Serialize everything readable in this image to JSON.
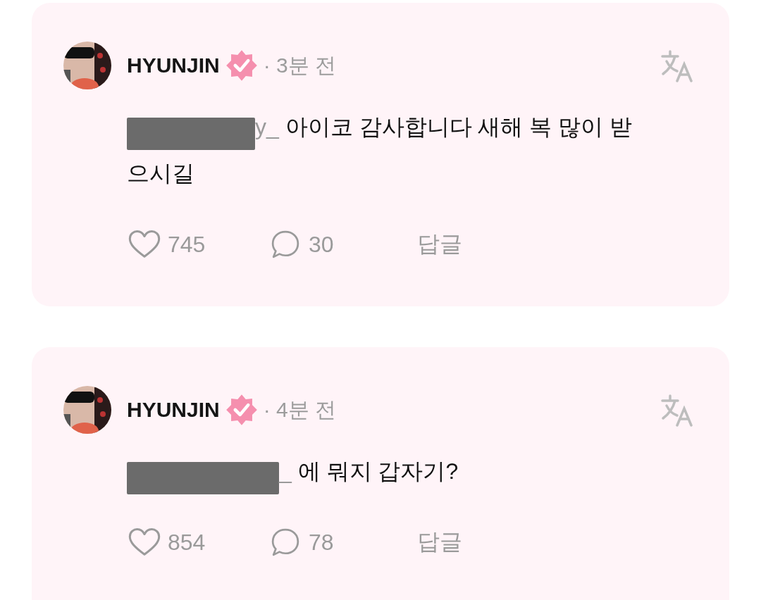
{
  "comments": [
    {
      "author": "HYUNJIN",
      "verified": true,
      "time": "· 3분 전",
      "redacted": true,
      "mention_tail": "y_",
      "text": "아이코 감사합니다 새해 복 많이 받으시길",
      "likes": "745",
      "replies": "30",
      "reply_label": "답글"
    },
    {
      "author": "HYUNJIN",
      "verified": true,
      "time": "· 4분 전",
      "redacted": true,
      "mention_tail": "_",
      "text": "에 뭐지 갑자기?",
      "likes": "854",
      "replies": "78",
      "reply_label": "답글"
    }
  ]
}
